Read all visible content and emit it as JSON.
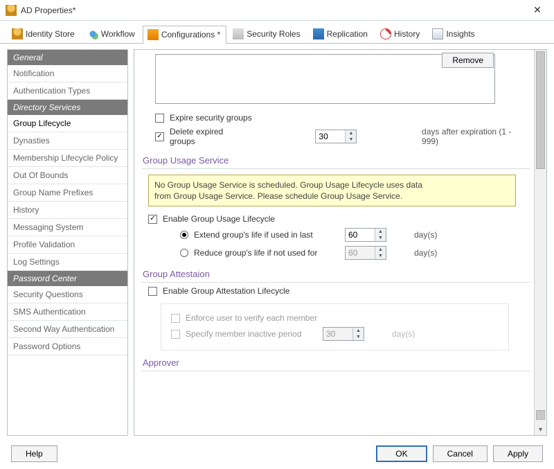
{
  "window": {
    "title": "AD Properties*"
  },
  "tabs": [
    {
      "label": "Identity Store",
      "icon": "identity-store-icon"
    },
    {
      "label": "Workflow",
      "icon": "workflow-icon"
    },
    {
      "label": "Configurations *",
      "icon": "configurations-icon",
      "active": true
    },
    {
      "label": "Security Roles",
      "icon": "security-roles-icon"
    },
    {
      "label": "Replication",
      "icon": "replication-icon"
    },
    {
      "label": "History",
      "icon": "history-icon"
    },
    {
      "label": "Insights",
      "icon": "insights-icon"
    }
  ],
  "sidebar": {
    "sections": [
      {
        "header": "General",
        "items": [
          "Notification",
          "Authentication Types"
        ]
      },
      {
        "header": "Directory Services",
        "items": [
          "Group Lifecycle",
          "Dynasties",
          "Membership Lifecycle Policy",
          "Out Of Bounds",
          "Group Name Prefixes",
          "History",
          "Messaging System",
          "Profile Validation",
          "Log Settings"
        ],
        "selected": "Group Lifecycle"
      },
      {
        "header": "Password Center",
        "items": [
          "Security Questions",
          "SMS Authentication",
          "Second Way Authentication",
          "Password Options"
        ]
      }
    ]
  },
  "content": {
    "remove_btn": "Remove",
    "expire_security_groups": {
      "label": "Expire security groups",
      "checked": false
    },
    "delete_expired_groups": {
      "label": "Delete expired groups",
      "checked": true,
      "value": "30",
      "suffix": "days after expiration (1 - 999)"
    },
    "sections": {
      "usage": {
        "title": "Group Usage Service",
        "notice_l1": "No Group Usage Service is scheduled. Group Usage Lifecycle uses data",
        "notice_l2": "from Group Usage Service. Please schedule Group Usage Service.",
        "enable": {
          "label": "Enable Group Usage Lifecycle",
          "checked": true
        },
        "extend": {
          "label": "Extend group's life if used in last",
          "value": "60",
          "unit": "day(s)",
          "selected": true
        },
        "reduce": {
          "label": "Reduce group's life if not used for",
          "value": "60",
          "unit": "day(s)",
          "selected": false
        }
      },
      "attestation": {
        "title": "Group Attestaion",
        "enable": {
          "label": "Enable Group Attestation Lifecycle",
          "checked": false
        },
        "enforce": {
          "label": "Enforce user to verify each member",
          "checked": false
        },
        "inactive": {
          "label": "Specify member inactive period",
          "value": "30",
          "unit": "day(s)",
          "checked": false
        }
      },
      "approver": {
        "title": "Approver"
      }
    }
  },
  "footer": {
    "help": "Help",
    "ok": "OK",
    "cancel": "Cancel",
    "apply": "Apply"
  }
}
